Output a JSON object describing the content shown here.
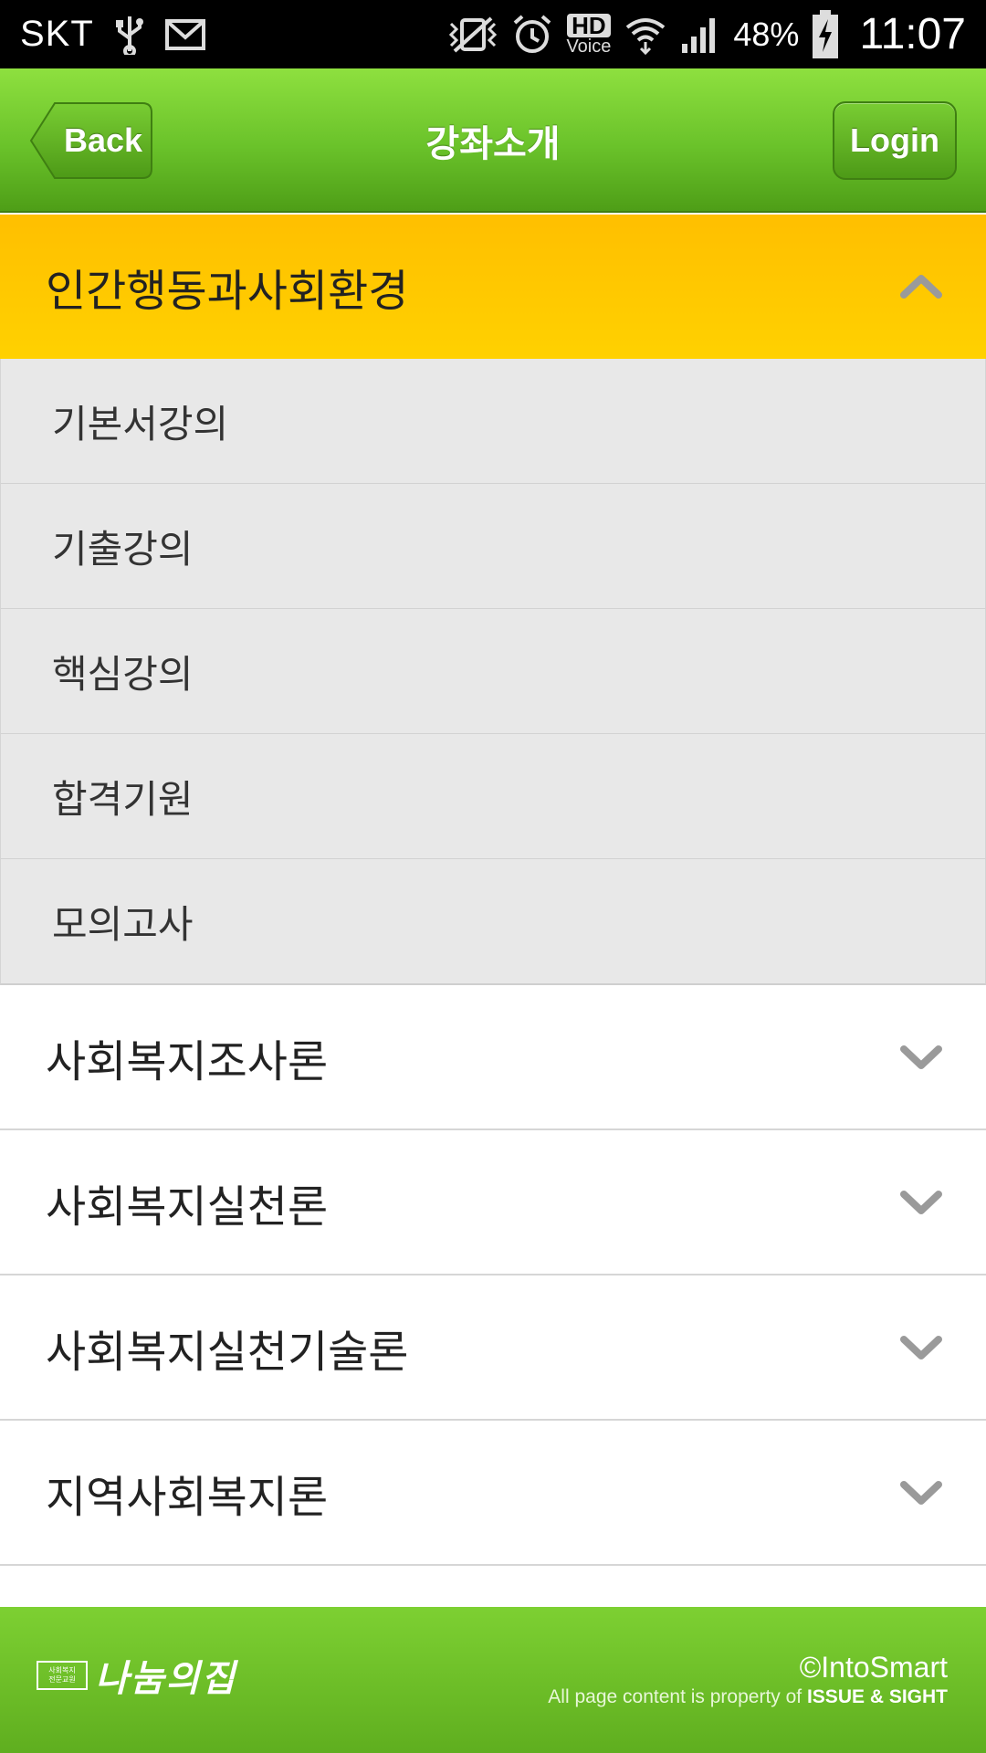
{
  "status_bar": {
    "carrier": "SKT",
    "battery_percent": "48%",
    "time": "11:07",
    "hd_label": "HD",
    "voice_label": "Voice",
    "icons": [
      "usb-icon",
      "gmail-icon",
      "vibrate-icon",
      "alarm-icon",
      "hd-voice-icon",
      "wifi-icon",
      "signal-icon",
      "battery-charging-icon"
    ]
  },
  "header": {
    "back_label": "Back",
    "title": "강좌소개",
    "login_label": "Login",
    "colors": {
      "accent": "#6ac22a",
      "open_category": "#ffc800"
    }
  },
  "accordion": {
    "open_category": {
      "title": "인간행동과사회환경",
      "sub_items": [
        "기본서강의",
        "기출강의",
        "핵심강의",
        "합격기원",
        "모의고사"
      ]
    },
    "collapsed_categories": [
      "사회복지조사론",
      "사회복지실천론",
      "사회복지실천기술론",
      "지역사회복지론"
    ]
  },
  "footer": {
    "logo_small_line1": "사회복지",
    "logo_small_line2": "전문교원",
    "logo_text": "나눔의집",
    "copyright": "©IntoSmart",
    "property_prefix": "All page content is property of ",
    "property_owner": "ISSUE & SIGHT"
  }
}
